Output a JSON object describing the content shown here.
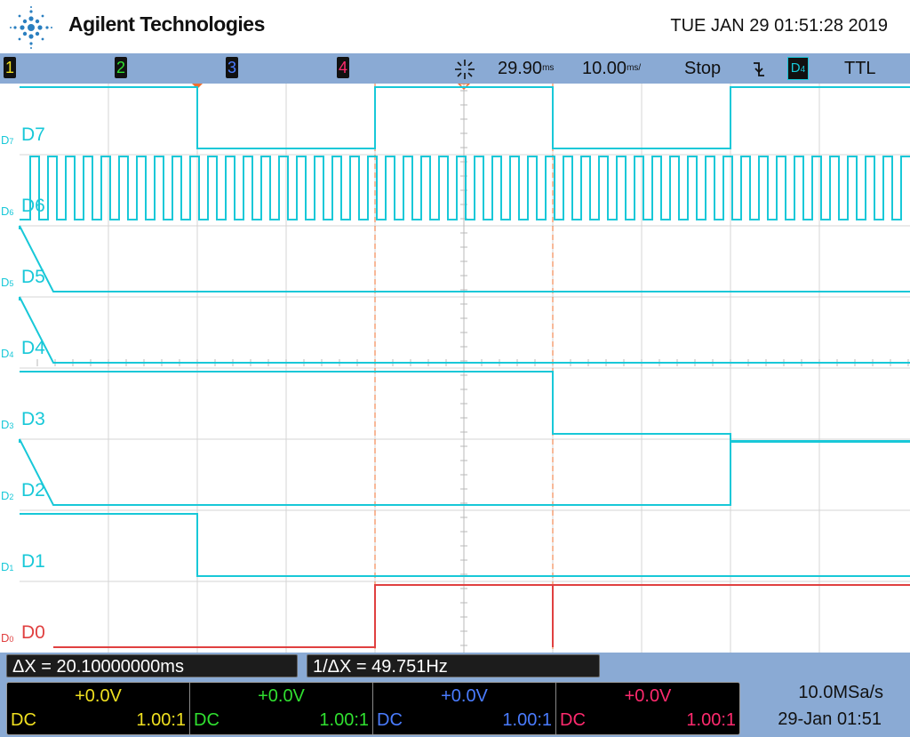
{
  "header": {
    "brand": "Agilent Technologies",
    "datetime": "TUE JAN 29 01:51:28 2019",
    "logo_icon": "agilent-spark-icon"
  },
  "status_bar": {
    "channels": [
      {
        "label": "1",
        "color": "#f0e020"
      },
      {
        "label": "2",
        "color": "#30e030"
      },
      {
        "label": "3",
        "color": "#4a7cff"
      },
      {
        "label": "4",
        "color": "#ff2a6e"
      }
    ],
    "delay_icon": "delay-star-icon",
    "delay_value": "29.90",
    "delay_unit": "ms",
    "timebase_value": "10.00",
    "timebase_unit": "ms/",
    "run_state": "Stop",
    "trigger_icon": "falling-edge-icon",
    "trigger_source": "D",
    "trigger_source_sub": "4",
    "threshold": "TTL"
  },
  "waveform": {
    "digital_channels": [
      {
        "label": "D7",
        "marker": "D",
        "marker_sub": "7"
      },
      {
        "label": "D6",
        "marker": "D",
        "marker_sub": "6"
      },
      {
        "label": "D5",
        "marker": "D",
        "marker_sub": "5"
      },
      {
        "label": "D4",
        "marker": "D",
        "marker_sub": "4"
      },
      {
        "label": "D3",
        "marker": "D",
        "marker_sub": "3"
      },
      {
        "label": "D2",
        "marker": "D",
        "marker_sub": "2"
      },
      {
        "label": "D1",
        "marker": "D",
        "marker_sub": "1"
      },
      {
        "label": "D0",
        "marker": "D",
        "marker_sub": "0"
      }
    ],
    "trace_color": "#18c8d8",
    "d0_color": "#e04040",
    "cursor_color": "#f07030"
  },
  "measurements": {
    "delta_x": "ΔX = 20.10000000ms",
    "inverse_delta_x": "1/ΔX = 49.751Hz"
  },
  "channel_settings": [
    {
      "offset": "+0.0V",
      "coupling": "DC",
      "probe": "1.00:1",
      "color": "#f0e020"
    },
    {
      "offset": "+0.0V",
      "coupling": "DC",
      "probe": "1.00:1",
      "color": "#30e030"
    },
    {
      "offset": "+0.0V",
      "coupling": "DC",
      "probe": "1.00:1",
      "color": "#4a7cff"
    },
    {
      "offset": "+0.0V",
      "coupling": "DC",
      "probe": "1.00:1",
      "color": "#ff2a6e"
    }
  ],
  "acquisition": {
    "sample_rate": "10.0MSa/s",
    "date_stamp": "29-Jan 01:51"
  }
}
